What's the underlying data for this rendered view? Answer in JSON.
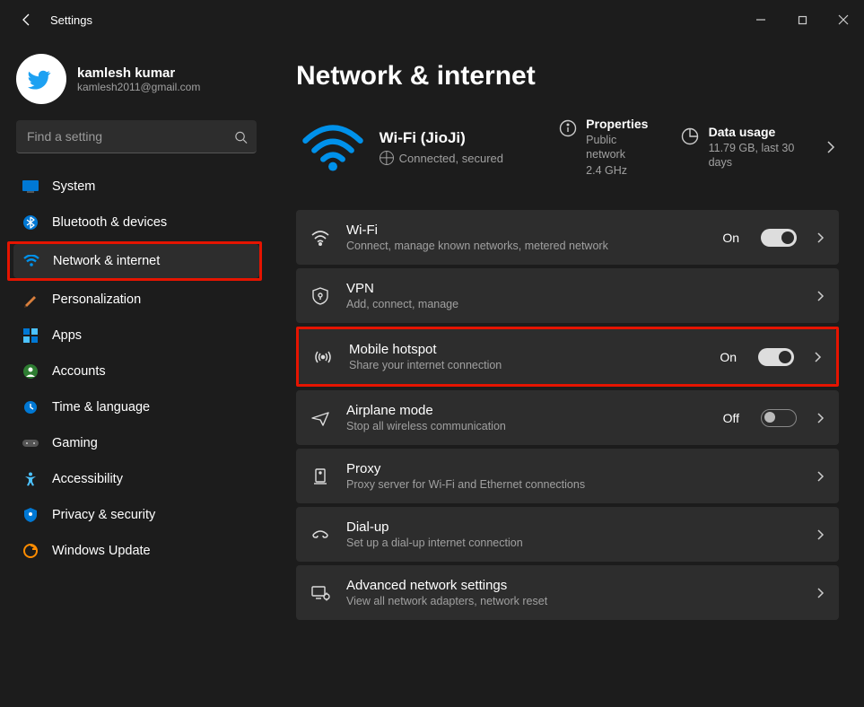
{
  "window": {
    "title": "Settings"
  },
  "profile": {
    "name": "kamlesh kumar",
    "email": "kamlesh2011@gmail.com"
  },
  "search": {
    "placeholder": "Find a setting"
  },
  "sidebar": {
    "items": [
      {
        "label": "System"
      },
      {
        "label": "Bluetooth & devices"
      },
      {
        "label": "Network & internet"
      },
      {
        "label": "Personalization"
      },
      {
        "label": "Apps"
      },
      {
        "label": "Accounts"
      },
      {
        "label": "Time & language"
      },
      {
        "label": "Gaming"
      },
      {
        "label": "Accessibility"
      },
      {
        "label": "Privacy & security"
      },
      {
        "label": "Windows Update"
      }
    ]
  },
  "page": {
    "title": "Network & internet"
  },
  "connection": {
    "name": "Wi-Fi (JioJi)",
    "status": "Connected, secured",
    "properties": {
      "title": "Properties",
      "sub1": "Public network",
      "sub2": "2.4 GHz"
    },
    "usage": {
      "title": "Data usage",
      "sub": "11.79 GB, last 30 days"
    }
  },
  "rows": {
    "wifi": {
      "title": "Wi-Fi",
      "sub": "Connect, manage known networks, metered network",
      "state": "On"
    },
    "vpn": {
      "title": "VPN",
      "sub": "Add, connect, manage"
    },
    "hotspot": {
      "title": "Mobile hotspot",
      "sub": "Share your internet connection",
      "state": "On"
    },
    "airplane": {
      "title": "Airplane mode",
      "sub": "Stop all wireless communication",
      "state": "Off"
    },
    "proxy": {
      "title": "Proxy",
      "sub": "Proxy server for Wi-Fi and Ethernet connections"
    },
    "dialup": {
      "title": "Dial-up",
      "sub": "Set up a dial-up internet connection"
    },
    "advanced": {
      "title": "Advanced network settings",
      "sub": "View all network adapters, network reset"
    }
  }
}
